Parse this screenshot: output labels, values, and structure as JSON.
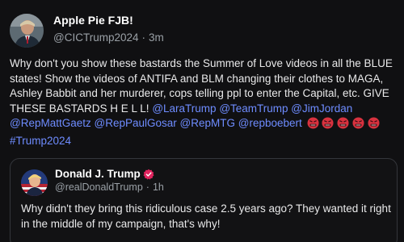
{
  "post": {
    "author_name": "Apple Pie FJB!",
    "handle": "@CICTrump2024",
    "separator": "·",
    "time_ago": "3m",
    "text_1": "Why don't you show these bastards the Summer of Love videos in all the BLUE states! Show the videos of ANTIFA and BLM changing their clothes to MAGA, Ashley Babbit and her murderer, cops telling ppl to enter the Capital, etc. GIVE THESE BASTARDS H E L L! ",
    "mentions": [
      "@LaraTrump",
      "@TeamTrump",
      "@JimJordan",
      "@RepMattGaetz",
      "@RepPaulGosar",
      "@RepMTG",
      "@repboebert"
    ],
    "emoji_icons": [
      "angry-face-icon",
      "angry-face-icon",
      "angry-face-icon",
      "angry-face-icon",
      "angry-face-icon"
    ],
    "hashtag": "#Trump2024"
  },
  "quoted_post": {
    "author_name": "Donald J. Trump",
    "handle": "@realDonaldTrump",
    "separator": "·",
    "time_ago": "1h",
    "text": "Why didn't they bring this ridiculous case 2.5 years ago? They wanted it right in the middle of my campaign, that's why!"
  },
  "colors": {
    "background": "#101012",
    "link": "#6e8cff",
    "verified_badge": "#e0245e",
    "muted_text": "#9aa0a6"
  }
}
